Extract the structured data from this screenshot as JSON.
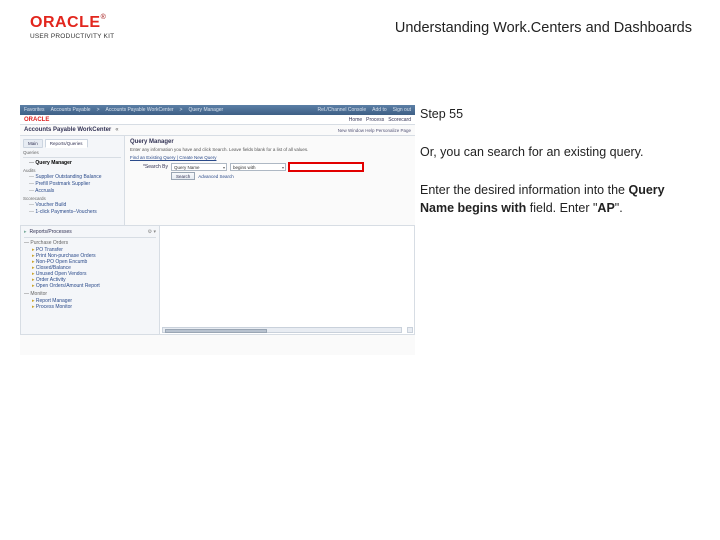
{
  "header": {
    "brand": "ORACLE",
    "brand_sub": "USER PRODUCTIVITY KIT",
    "title": "Understanding Work.Centers and Dashboards"
  },
  "panel": {
    "step": "Step 55",
    "p1": "Or, you can search for an existing query.",
    "p2a": "Enter the desired information into the ",
    "p2b": "Query Name begins with",
    "p2c": " field. Enter \"",
    "p2d": "AP",
    "p2e": "\"."
  },
  "shot": {
    "topnav": {
      "i1": "Favorites",
      "i2": "Accounts Payable",
      "i3": "Accounts Payable WorkCenter",
      "i4": "Query Manager",
      "sp": "",
      "r1": "Rel./Channel Console",
      "r2": "Add to",
      "r3": "Sign out"
    },
    "orc": {
      "brand": "ORACLE",
      "l1": "Home",
      "l2": "Process",
      "l3": "Scorecard"
    },
    "wc": {
      "title": "Accounts Payable WorkCenter",
      "right": "New Window   Help   Personalize Page"
    },
    "side": {
      "tab_main": "Main",
      "tab_reports": "Reports/Queries",
      "sec1": "Queries",
      "qm": "Query Manager",
      "sec2": "Audits",
      "a1": "Supplier Outstanding Balance",
      "a2": "Prefill Postmark Supplier",
      "a3": "Accruals",
      "sec3": "Scorecards",
      "s1": "Voucher Build",
      "s2": "1-click Payments–Vouchers"
    },
    "content": {
      "title": "Query Manager",
      "desc": "Enter any information you have and click Search. Leave fields blank for a list of all values.",
      "find": "Find an Existing Query  |  Create New Query",
      "lbl_search": "*Search By",
      "sel_search": "Query Name",
      "sel_cond": "begins with",
      "btn_search": "Search",
      "adv": "Advanced Search"
    },
    "lower": {
      "hdr": "Reports/Processes",
      "g1": "Purchase Orders",
      "i1": "PO Transfer",
      "i2": "Print Non-purchase Orders",
      "i3": "Non-PO Open Encumb",
      "i4": "Closed/Balance",
      "i5": "Unused Open Vendors",
      "i6": "Order Activity",
      "i7": "Open Orders/Amount Report",
      "g2": "Monitor",
      "m1": "Report Manager",
      "m2": "Process Monitor"
    }
  }
}
